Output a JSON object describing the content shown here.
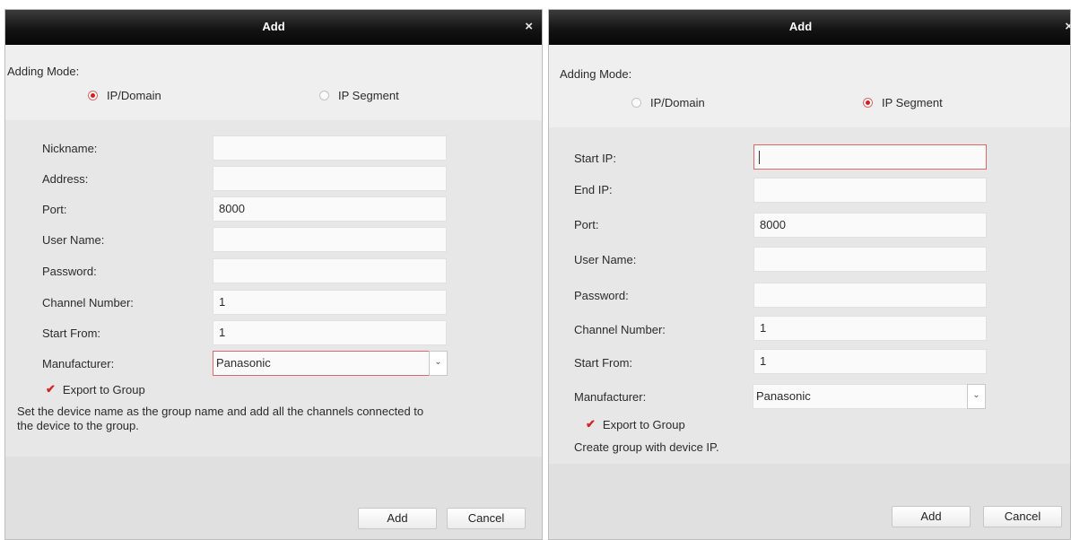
{
  "dialogs": [
    {
      "title": "Add",
      "close": "×",
      "mode_label": "Adding Mode:",
      "modes": [
        {
          "label": "IP/Domain",
          "selected": true
        },
        {
          "label": "IP Segment",
          "selected": false
        }
      ],
      "fields": [
        {
          "label": "Nickname:",
          "value": ""
        },
        {
          "label": "Address:",
          "value": ""
        },
        {
          "label": "Port:",
          "value": "8000"
        },
        {
          "label": "User Name:",
          "value": ""
        },
        {
          "label": "Password:",
          "value": ""
        },
        {
          "label": "Channel Number:",
          "value": "1"
        },
        {
          "label": "Start From:",
          "value": "1"
        }
      ],
      "manufacturer": {
        "label": "Manufacturer:",
        "value": "Panasonic"
      },
      "export": {
        "label": "Export to Group",
        "checked": true
      },
      "note": "Set the device name as the group name and add all the channels connected to the device to the group.",
      "buttons": {
        "add": "Add",
        "cancel": "Cancel"
      }
    },
    {
      "title": "Add",
      "close": "×",
      "mode_label": "Adding Mode:",
      "modes": [
        {
          "label": "IP/Domain",
          "selected": false
        },
        {
          "label": "IP Segment",
          "selected": true
        }
      ],
      "fields": [
        {
          "label": "Start IP:",
          "value": ""
        },
        {
          "label": "End IP:",
          "value": ""
        },
        {
          "label": "Port:",
          "value": "8000"
        },
        {
          "label": "User Name:",
          "value": ""
        },
        {
          "label": "Password:",
          "value": ""
        },
        {
          "label": "Channel Number:",
          "value": "1"
        },
        {
          "label": "Start From:",
          "value": "1"
        }
      ],
      "manufacturer": {
        "label": "Manufacturer:",
        "value": "Panasonic"
      },
      "export": {
        "label": "Export to Group",
        "checked": true
      },
      "note": "Create group with device IP.",
      "buttons": {
        "add": "Add",
        "cancel": "Cancel"
      }
    }
  ],
  "colors": {
    "titlebar": "#0b0b0b",
    "accent": "#d22020",
    "dialog_bg": "#efefef",
    "panel_bg": "#e7e7e7"
  },
  "icons": {
    "close": "close-icon",
    "radio": "radio-icon",
    "check": "checkmark-icon",
    "dropdown": "chevron-down-icon"
  }
}
